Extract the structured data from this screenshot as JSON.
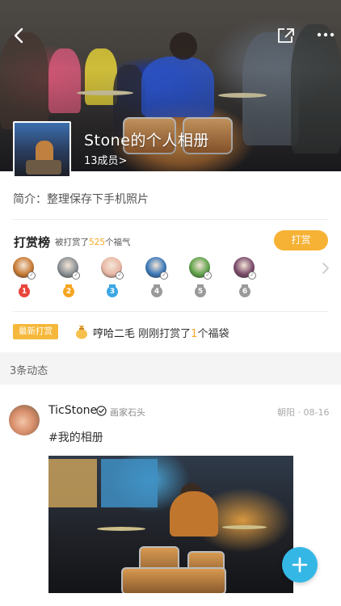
{
  "header": {
    "album_title": "Stone的个人相册",
    "members": "13成员>"
  },
  "intro": {
    "text": "简介：整理保存下手机照片"
  },
  "reward": {
    "title": "打赏榜",
    "subtitle_prefix": "被打赏了",
    "subtitle_count": "525",
    "subtitle_suffix": "个福气",
    "button_label": "打赏",
    "ranks": [
      {
        "number": "1",
        "medal_color": "#e8453c",
        "avatar_color": "#c87a33"
      },
      {
        "number": "2",
        "medal_color": "#f5a623",
        "avatar_color": "#8a8f93"
      },
      {
        "number": "3",
        "medal_color": "#3ba7e3",
        "avatar_color": "#e9b7a4"
      },
      {
        "number": "4",
        "medal_color": "#9a9a9a",
        "avatar_color": "#3b78b8"
      },
      {
        "number": "5",
        "medal_color": "#9a9a9a",
        "avatar_color": "#5fa24a"
      },
      {
        "number": "6",
        "medal_color": "#9a9a9a",
        "avatar_color": "#7a4a6a"
      }
    ]
  },
  "latest": {
    "badge": "最新打赏",
    "username": "哼哈二毛",
    "action": " 刚刚打赏了",
    "count": "1",
    "suffix": "个福袋"
  },
  "feed": {
    "section_label": "3条动态"
  },
  "post": {
    "username": "TicStone",
    "tag": "画家石头",
    "meta": "朝阳 · 08-16",
    "caption": "#我的相册"
  },
  "colors": {
    "accent_orange": "#f6b234",
    "fab_blue": "#35b7e6"
  },
  "icons": [
    "back-icon",
    "share-icon",
    "more-icon",
    "chevron-right-icon",
    "bag-icon",
    "verify-icon",
    "plus-icon"
  ]
}
